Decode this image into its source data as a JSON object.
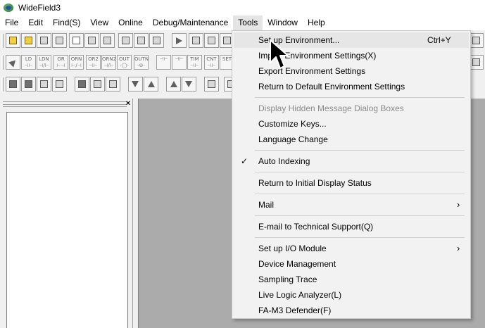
{
  "window": {
    "title": "WideField3"
  },
  "menubar": [
    {
      "label": "File"
    },
    {
      "label": "Edit"
    },
    {
      "label": "Find(S)"
    },
    {
      "label": "View"
    },
    {
      "label": "Online"
    },
    {
      "label": "Debug/Maintenance"
    },
    {
      "label": "Tools"
    },
    {
      "label": "Window"
    },
    {
      "label": "Help"
    }
  ],
  "toolbar_ladder": [
    {
      "top": "LD",
      "bottom": "⊣⊢"
    },
    {
      "top": "LDN",
      "bottom": "⊣/⊢"
    },
    {
      "top": "OR",
      "bottom": "⊢⊣"
    },
    {
      "top": "ORN",
      "bottom": "⊢/⊣"
    },
    {
      "top": "OR2",
      "bottom": "⊣⊢"
    },
    {
      "top": "ORN2",
      "bottom": "⊣/⊢"
    },
    {
      "top": "OUT",
      "bottom": "-◯-"
    },
    {
      "top": "OUTN",
      "bottom": "-⊘-"
    },
    {
      "top": "TIM",
      "bottom": "⊣⊢"
    },
    {
      "top": "CNT",
      "bottom": "⊣⊢"
    },
    {
      "top": "SET",
      "bottom": ""
    }
  ],
  "left_pane": {
    "close_glyph": "×"
  },
  "tools_menu": {
    "items": [
      {
        "label": "Set up Environment...",
        "shortcut": "Ctrl+Y",
        "highlighted": true
      },
      {
        "label": "Import Environment Settings(X)"
      },
      {
        "label": "Export Environment Settings"
      },
      {
        "label": "Return to Default Environment Settings"
      },
      {
        "label": "Display Hidden Message Dialog Boxes",
        "disabled": true
      },
      {
        "label": "Customize Keys..."
      },
      {
        "label": "Language Change"
      },
      {
        "label": "Auto Indexing",
        "checked": true,
        "check_glyph": "✓"
      },
      {
        "label": "Return to Initial Display Status"
      },
      {
        "label": "Mail",
        "submenu_glyph": "›"
      },
      {
        "label": "E-mail to Technical Support(Q)"
      },
      {
        "label": "Set up I/O Module",
        "submenu_glyph": "›"
      },
      {
        "label": "Device Management"
      },
      {
        "label": "Sampling Trace"
      },
      {
        "label": "Live Logic Analyzer(L)"
      },
      {
        "label": "FA-M3 Defender(F)"
      }
    ]
  },
  "colors": {
    "menu_highlight": "#e6e6e6",
    "mdi_background": "#ababab",
    "disabled_text": "#8a8a8a"
  },
  "icons": [
    "app-icon",
    "new-program-icon",
    "open-folder-icon",
    "cursor-arrow-icon",
    "check-icon",
    "submenu-arrow-icon",
    "close-icon"
  ]
}
